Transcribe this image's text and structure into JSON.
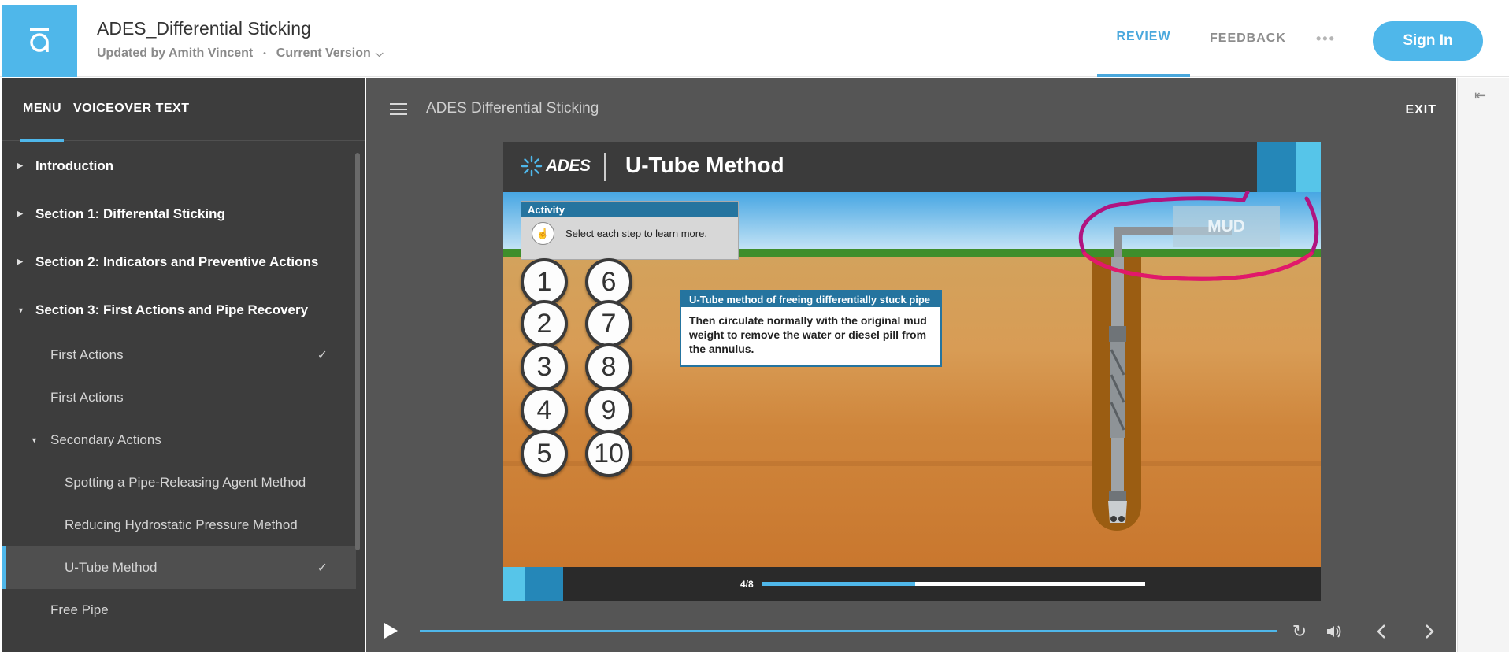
{
  "header": {
    "title": "ADES_Differential Sticking",
    "updated_by": "Updated by Amith Vincent",
    "separator": "•",
    "version": "Current Version",
    "nav": {
      "review": "REVIEW",
      "feedback": "FEEDBACK",
      "more": "•••"
    },
    "signin": "Sign In"
  },
  "sidebar": {
    "tabs": {
      "menu": "MENU",
      "voiceover": "VOICEOVER TEXT"
    },
    "items": [
      {
        "label": "Introduction"
      },
      {
        "label": "Section 1: Differental Sticking"
      },
      {
        "label": "Section 2: Indicators and Preventive Actions"
      },
      {
        "label": "Section 3: First Actions and Pipe Recovery"
      },
      {
        "label": "First Actions",
        "completed": true
      },
      {
        "label": "First Actions"
      },
      {
        "label": "Secondary Actions"
      },
      {
        "label": "Spotting a Pipe-Releasing Agent Method"
      },
      {
        "label": "Reducing Hydrostatic Pressure Method"
      },
      {
        "label": "U-Tube Method",
        "completed": true,
        "active": true
      },
      {
        "label": "Free Pipe"
      }
    ],
    "check_glyph": "✓"
  },
  "player": {
    "title": "ADES Differential Sticking",
    "exit": "EXIT",
    "progress_fraction": 1.0
  },
  "slide": {
    "logo": "ADES",
    "title": "U-Tube Method",
    "activity": {
      "header": "Activity",
      "text": "Select each step to learn more."
    },
    "steps": [
      "1",
      "2",
      "3",
      "4",
      "5",
      "6",
      "7",
      "8",
      "9",
      "10"
    ],
    "info": {
      "header": "U-Tube method of freeing differentially stuck pipe",
      "body": "Then circulate normally with the original mud weight to remove the water or diesel pill from  the annulus."
    },
    "mud_label": "MUD",
    "page": "4/8",
    "page_progress": 0.4,
    "colors": {
      "accent_light": "#56c5e9",
      "accent_dark": "#2587b8",
      "scribble": "#d6186b"
    }
  },
  "icons": {
    "play": "play-icon",
    "replay": "replay-icon",
    "volume": "volume-icon",
    "prev": "chevron-left-icon",
    "next": "chevron-right-icon",
    "collapse": "collapse-panel-icon"
  },
  "colors": {
    "brand": "#4fb7ea",
    "sidebar_bg": "#3d3d3d",
    "player_bg": "#555555"
  }
}
